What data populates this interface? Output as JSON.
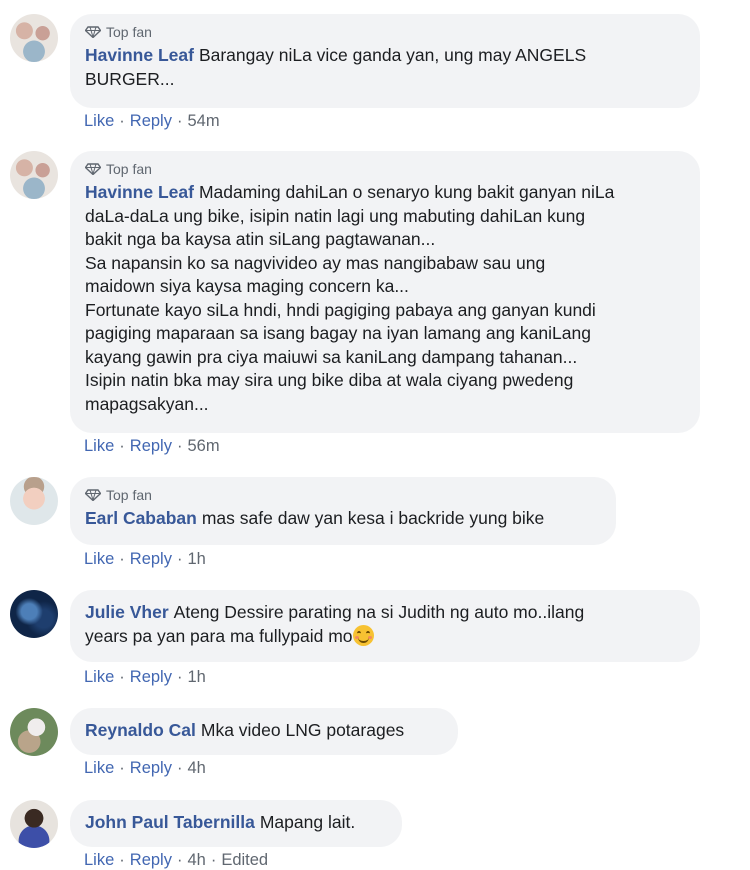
{
  "colors": {
    "author": "#385898",
    "link": "#4267b2",
    "meta": "#606770",
    "bubble": "#f2f3f5",
    "text": "#1c1e21"
  },
  "comments": [
    {
      "avatar": "family-photo",
      "badge": "Top fan",
      "author": "Havinne Leaf",
      "text": "Barangay niLa vice ganda yan, ung may ANGELS\nBURGER...",
      "like": "Like",
      "reply": "Reply",
      "time": "54m"
    },
    {
      "avatar": "family-photo",
      "badge": "Top fan",
      "author": "Havinne Leaf",
      "text": "Madaming dahiLan o senaryo kung bakit ganyan niLa\ndaLa-daLa ung bike, isipin natin lagi ung mabuting dahiLan kung\nbakit nga ba kaysa atin siLang pagtawanan...\nSa napansin ko sa nagvivideo ay mas nangibabaw sau ung\nmaidown siya kaysa maging concern ka...\nFortunate kayo siLa hndi, hndi pagiging pabaya ang ganyan kundi\npagiging maparaan sa isang bagay na iyan lamang ang kaniLang\nkayang gawin pra ciya maiuwi sa kaniLang dampang tahanan...\nIsipin natin bka may sira ung bike diba at wala ciyang pwedeng\nmapagsakyan...",
      "like": "Like",
      "reply": "Reply",
      "time": "56m"
    },
    {
      "avatar": "baby-photo",
      "badge": "Top fan",
      "author": "Earl Cababan",
      "text": "mas safe daw yan kesa i backride yung bike",
      "like": "Like",
      "reply": "Reply",
      "time": "1h"
    },
    {
      "avatar": "blue-abstract",
      "author": "Julie Vher",
      "text": "Ateng Dessire parating na si Judith ng auto mo..ilang\nyears pa yan para ma fullypaid mo",
      "emoji": "smiling-face-emoji",
      "like": "Like",
      "reply": "Reply",
      "time": "1h"
    },
    {
      "avatar": "wedding-photo",
      "author": "Reynaldo Cal",
      "text": "Mka video LNG potarages",
      "like": "Like",
      "reply": "Reply",
      "time": "4h"
    },
    {
      "avatar": "woman-portrait",
      "author": "John Paul Tabernilla",
      "text": "Mapang lait.",
      "like": "Like",
      "reply": "Reply",
      "time": "4h",
      "edited": "Edited"
    }
  ]
}
